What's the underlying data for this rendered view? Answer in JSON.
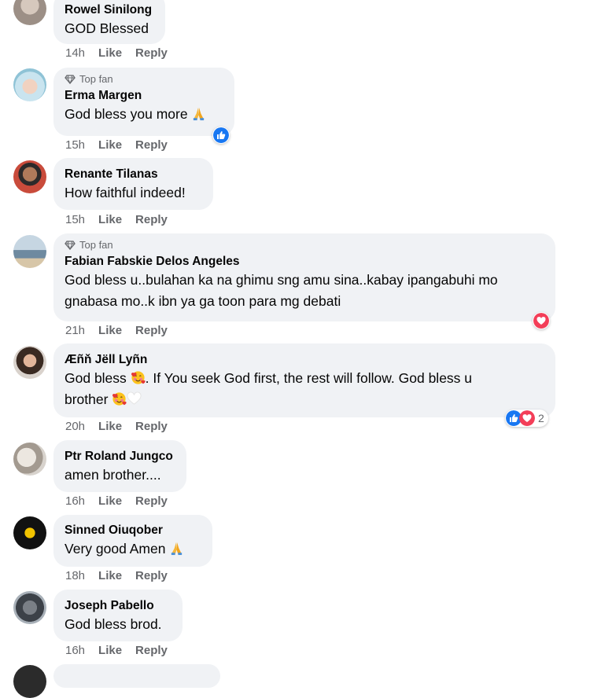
{
  "comments": [
    {
      "name": "Rowel Sinilong",
      "text": "GOD Blessed",
      "time": "14h"
    },
    {
      "top_fan": "Top fan",
      "name": "Erma Margen",
      "text": "God bless you more",
      "time": "15h"
    },
    {
      "name": "Renante Tilanas",
      "text": "How faithful indeed!",
      "time": "15h"
    },
    {
      "top_fan": "Top fan",
      "name": "Fabian Fabskie Delos Angeles",
      "text1": "God bless u..bulahan ka na ghimu sng amu sina..kabay ipangabuhi mo",
      "text2": "gnabasa mo..k ibn ya ga toon para mg debati",
      "time": "21h"
    },
    {
      "name": "Æñň Jëll Lyñn",
      "text1a": "God bless",
      "text1b": ". If You seek God first, the rest will follow. God bless u",
      "text2": "brother",
      "time": "20h",
      "reaction_count": "2"
    },
    {
      "name": "Ptr Roland Jungco",
      "text": "amen brother....",
      "time": "16h"
    },
    {
      "name": "Sinned Oiuqober",
      "text": "Very good Amen",
      "time": "18h"
    },
    {
      "name": "Joseph Pabello",
      "text": "God bless brod.",
      "time": "16h"
    }
  ],
  "actions": {
    "like": "Like",
    "reply": "Reply"
  },
  "icons": {
    "like": "like-reaction-icon",
    "love": "love-reaction-icon",
    "diamond": "diamond-icon",
    "pray": "praying-hands-emoji",
    "heart_face": "smiling-face-with-hearts-emoji",
    "white_heart": "white-heart-emoji"
  },
  "colors": {
    "bubble": "#f0f2f5",
    "meta": "#65676b",
    "like_blue": "#1877f2",
    "love_red": "#f33e58"
  }
}
